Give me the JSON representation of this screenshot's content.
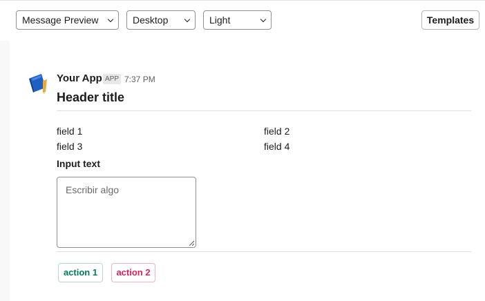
{
  "toolbar": {
    "preview_select": "Message Preview",
    "device_select": "Desktop",
    "theme_select": "Light",
    "templates_label": "Templates"
  },
  "message": {
    "app_name": "Your App",
    "app_badge": "APP",
    "time": "7:37 PM",
    "header_title": "Header title",
    "fields": [
      "field 1",
      "field 2",
      "field 3",
      "field 4"
    ],
    "input_label": "Input text",
    "input_placeholder": "Escribir algo",
    "actions": [
      {
        "label": "action 1",
        "style": "primary",
        "color": "#007a5a"
      },
      {
        "label": "action 2",
        "style": "danger",
        "color": "#e01e5a"
      }
    ]
  },
  "icons": {
    "avatar": "app-book-icon",
    "dropdown": "chevron-down-icon"
  }
}
